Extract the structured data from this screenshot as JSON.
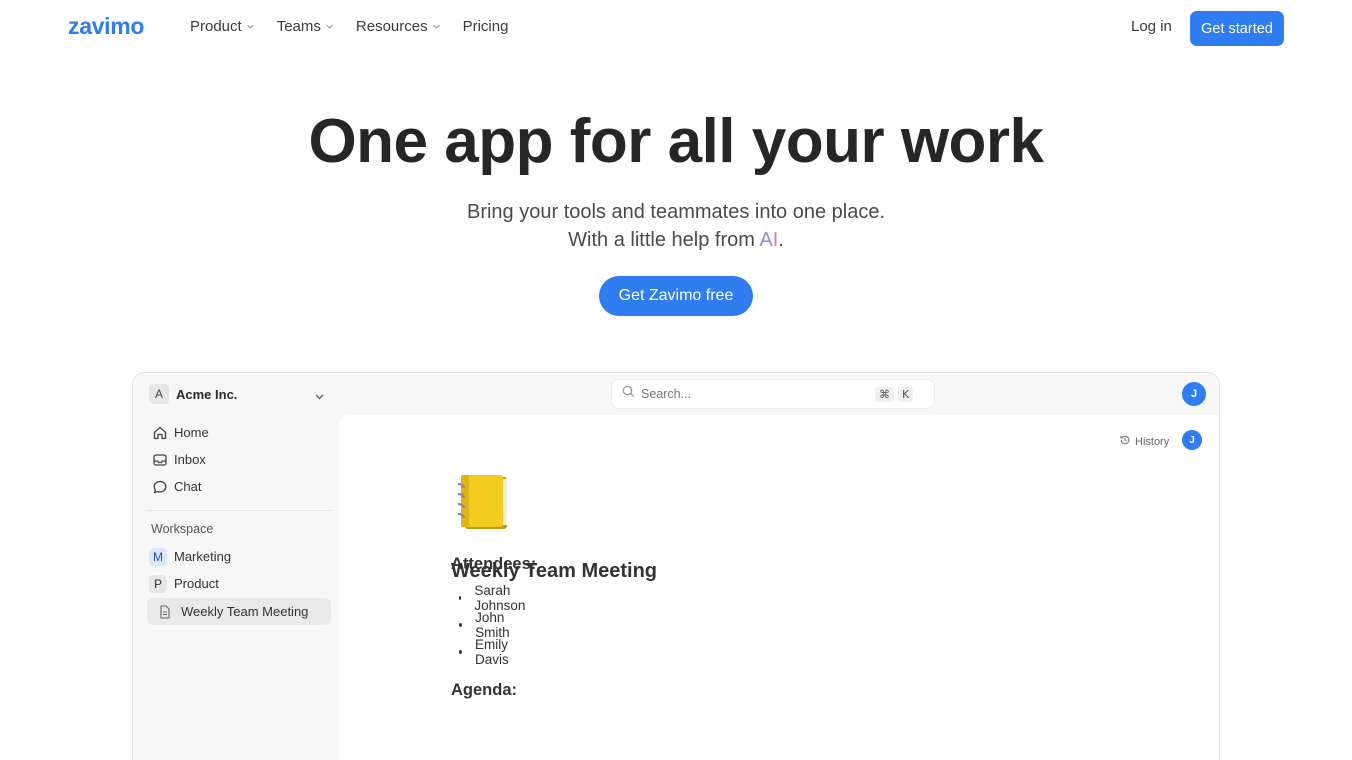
{
  "nav": {
    "logo": "zavimo",
    "links": [
      "Product",
      "Teams",
      "Resources",
      "Pricing"
    ],
    "login": "Log in",
    "get_started": "Get started"
  },
  "hero": {
    "title": "One app for all your work",
    "line1": "Bring your tools and teammates into one place.",
    "line2_pre": "With a little help from ",
    "line2_ai": "AI",
    "line2_post": ".",
    "cta": "Get Zavimo free"
  },
  "app": {
    "workspace_badge": "A",
    "workspace_name": "Acme Inc.",
    "search_placeholder": "Search...",
    "search_key1": "⌘",
    "search_key2": "K",
    "avatar": "J",
    "sidebar": {
      "items": [
        "Home",
        "Inbox",
        "Chat"
      ],
      "section": "Workspace",
      "workspaces": [
        {
          "letter": "M",
          "name": "Marketing"
        },
        {
          "letter": "P",
          "name": "Product"
        }
      ],
      "active_page": "Weekly Team Meeting"
    },
    "doc": {
      "history": "History",
      "avatar": "J",
      "emoji": "📒",
      "title": "Weekly Team Meeting",
      "attendees_heading": "Attendees:",
      "attendees": [
        "Sarah Johnson",
        "John Smith",
        "Emily Davis"
      ],
      "agenda_heading": "Agenda:"
    }
  },
  "colors": {
    "accent": "#2f7df0",
    "title": "#262626",
    "app_bg": "#f7f7f7"
  }
}
